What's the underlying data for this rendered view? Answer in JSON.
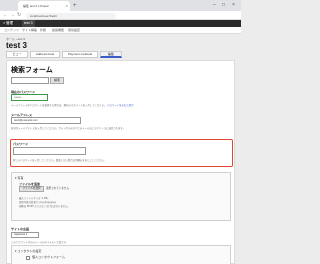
{
  "browser": {
    "tab_title": "編集 test 3 | Drupal",
    "tab_close": "×",
    "new_tab": "+",
    "controls": [
      "–",
      "□",
      "×"
    ],
    "nav": [
      "←",
      "→",
      "↻"
    ],
    "url": "localhost/user/3/edit"
  },
  "toolbar": {
    "menu": "≡ 管理",
    "user": "test 3"
  },
  "subnav": {
    "items": [
      "コンテンツ",
      "サイト構築",
      "外観",
      "拡張機能",
      "環境設定"
    ]
  },
  "breadcrumb": "ホーム › test 3",
  "page_title": "test 3",
  "tabs": [
    {
      "label": "ビュー"
    },
    {
      "label": "Address book"
    },
    {
      "label": "Payment methods"
    },
    {
      "label": "編集"
    }
  ],
  "form": {
    "heading": "検索フォーム",
    "search_value": "",
    "search_button": "検索",
    "current_password_label": "現在のパスワード",
    "current_password_value": "••••••••",
    "current_password_help": "メールアドレスやパスワードを変更する場合は、現在のパスワードを入力してください。",
    "current_password_help_link": "パスワードを忘れた場合",
    "email_label": "メールアドレス",
    "email_value": "test3@example.com",
    "email_help": "有効なメールアドレスを入力してください。サイトからのすべてのメールはこのアドレスに送信されます。",
    "password_label": "パスワード",
    "password_value": "",
    "password_help": "新しいパスワードを入力してください。変更しない場合は空欄のままにしてください。",
    "picture_summary": "▾ 写真",
    "picture_label": "ファイルを追加",
    "file_button": "ファイルを選択",
    "file_text": "選択されていません",
    "file_help": [
      "最大ファイルサイズ: 2 MB。",
      "使用可能な拡張子: png gif jpg jpeg",
      "画像は 85×85 より大きくなければなりません。"
    ],
    "language_label": "サイトの言語",
    "language_value": "Japanese ▾",
    "language_help": "このアカウントからのメールのデフォルト言語です。",
    "contact_summary": "▾ コンタクトの設定",
    "contact_checkbox": "個人コンタクトフォーム"
  }
}
